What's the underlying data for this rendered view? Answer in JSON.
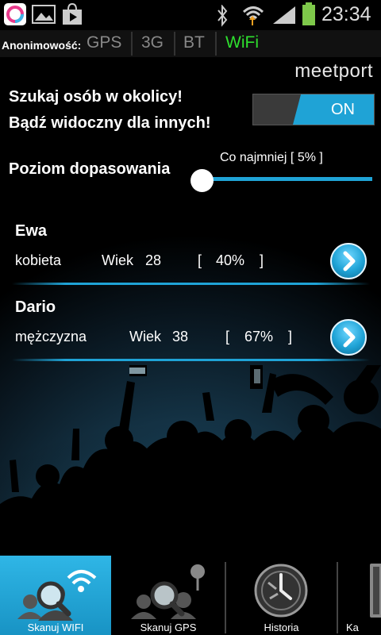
{
  "statusbar": {
    "time": "23:34",
    "colors": {
      "battery": "#7ec84a"
    }
  },
  "anonymity": {
    "label": "Anonimowość:",
    "options": [
      "GPS",
      "3G",
      "BT",
      "WiFi"
    ],
    "active": "WiFi",
    "colors": {
      "active": "#2ee02e",
      "inactive": "#8a8a8a"
    }
  },
  "brand": {
    "logo": "meetport"
  },
  "search": {
    "line1": "Szukaj osób w okolicy!",
    "line2": "Bądź widoczny dla innych!",
    "toggle_label": "ON",
    "toggle_on": true
  },
  "match": {
    "label": "Poziom dopasowania",
    "caption": "Co najmniej [ 5% ]",
    "value_percent": 5
  },
  "people": [
    {
      "name": "Ewa",
      "gender": "kobieta",
      "age_label": "Wiek",
      "age": "28",
      "bracket_open": "[",
      "match": "40%",
      "bracket_close": "]"
    },
    {
      "name": "Dario",
      "gender": "mężczyzna",
      "age_label": "Wiek",
      "age": "38",
      "bracket_open": "[",
      "match": "67%",
      "bracket_close": "]"
    }
  ],
  "tabs": [
    {
      "label": "Skanuj WIFI",
      "icon": "scan-wifi-icon",
      "active": true
    },
    {
      "label": "Skanuj GPS",
      "icon": "scan-gps-icon",
      "active": false
    },
    {
      "label": "Historia",
      "icon": "history-icon",
      "active": false
    },
    {
      "label": "Ka",
      "icon": "card-icon",
      "active": false
    }
  ],
  "colors": {
    "accent": "#1fa3d6",
    "active_tab": "#1fa3d6"
  }
}
